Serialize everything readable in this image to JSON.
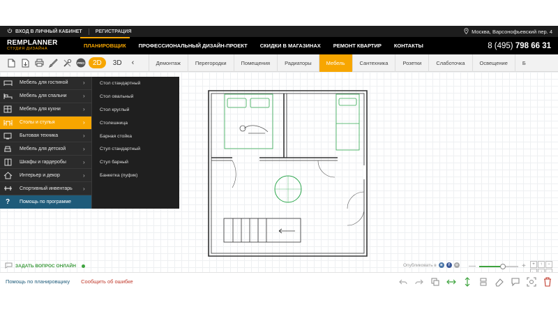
{
  "topbar": {
    "login": "ВХОД В ЛИЧНЫЙ КАБИНЕТ",
    "register": "РЕГИСТРАЦИЯ",
    "address": "Москва, Варсонофьевский пер. 4"
  },
  "header": {
    "logo_top": "REMPLANNER",
    "logo_bottom": "СТУДИЯ ДИЗАЙНА",
    "nav": [
      "ПЛАНИРОВЩИК",
      "ПРОФЕССИОНАЛЬНЫЙ ДИЗАЙН-ПРОЕКТ",
      "СКИДКИ В МАГАЗИНАХ",
      "РЕМОНТ КВАРТИР",
      "КОНТАКТЫ"
    ],
    "phone_prefix": "8 (495)",
    "phone_number": "798 66 31"
  },
  "toolbar": {
    "pro_badge": "PRO",
    "view_2d": "2D",
    "view_3d": "3D",
    "prev": "‹",
    "categories": [
      "Демонтаж",
      "Перегородки",
      "Помещения",
      "Радиаторы",
      "Мебель",
      "Сантехника",
      "Розетки",
      "Слаботочка",
      "Освещение",
      "Б"
    ]
  },
  "menu": {
    "items": [
      {
        "label": "Мебель для гостиной",
        "icon": "sofa-icon"
      },
      {
        "label": "Мебель для спальни",
        "icon": "bed-icon"
      },
      {
        "label": "Мебель для кухни",
        "icon": "kitchen-icon"
      },
      {
        "label": "Столы и стулья",
        "icon": "table-chair-icon"
      },
      {
        "label": "Бытовая техника",
        "icon": "tv-icon"
      },
      {
        "label": "Мебель для детской",
        "icon": "kids-icon"
      },
      {
        "label": "Шкафы и гардеробы",
        "icon": "wardrobe-icon"
      },
      {
        "label": "Интерьер и декор",
        "icon": "house-icon"
      },
      {
        "label": "Спортивный инвентарь",
        "icon": "sport-icon"
      }
    ],
    "help": "Помощь по программе",
    "help_icon_text": "?",
    "arrow": "›",
    "subitems": [
      "Стол стандартный",
      "Стол овальный",
      "Стол круглый",
      "Столешница",
      "Барная стойка",
      "Стул стандартный",
      "Стул барный",
      "Банкетка (пуфик)"
    ]
  },
  "canvas": {
    "ask_online": "ЗАДАТЬ ВОПРОС ОНЛАЙН",
    "publish_label": "Опубликовать в",
    "social": [
      {
        "text": "в",
        "color": "#4a76a8"
      },
      {
        "text": "f",
        "color": "#3b5998"
      },
      {
        "text": "о",
        "color": "#aaaaaa"
      }
    ],
    "zoom_minus": "—",
    "zoom_plus": "+",
    "zoom_level": 0.6,
    "arrows": [
      "+",
      "↑",
      "−",
      "←",
      "↓",
      "→"
    ],
    "accent": "#f7a600",
    "help_color": "#1e5b7a"
  },
  "bottombar": {
    "help_link": "Помощь по планировщику",
    "error_link": "Сообщить об ошибке"
  }
}
